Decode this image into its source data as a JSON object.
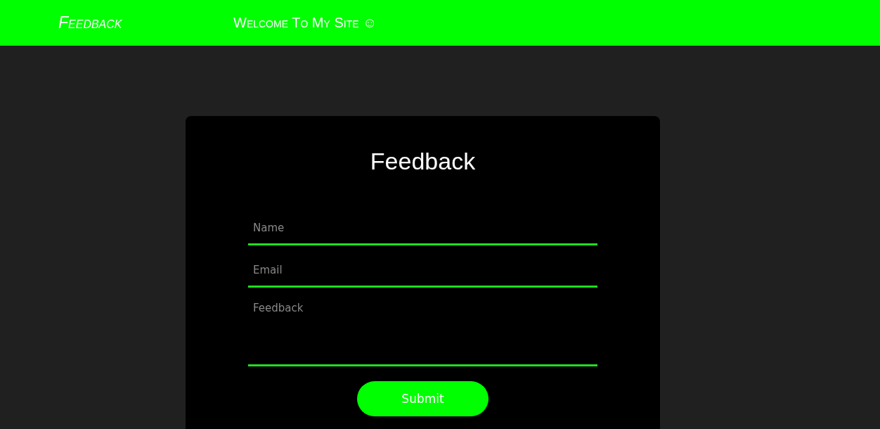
{
  "header": {
    "brand": "Feedback",
    "welcome": "Welcome To My Site ☺"
  },
  "form": {
    "title": "Feedback",
    "fields": [
      {
        "kind": "input",
        "placeholder": "Name"
      },
      {
        "kind": "input",
        "placeholder": "Email"
      },
      {
        "kind": "textarea",
        "placeholder": "Feedback"
      }
    ],
    "submit": "Submit"
  }
}
